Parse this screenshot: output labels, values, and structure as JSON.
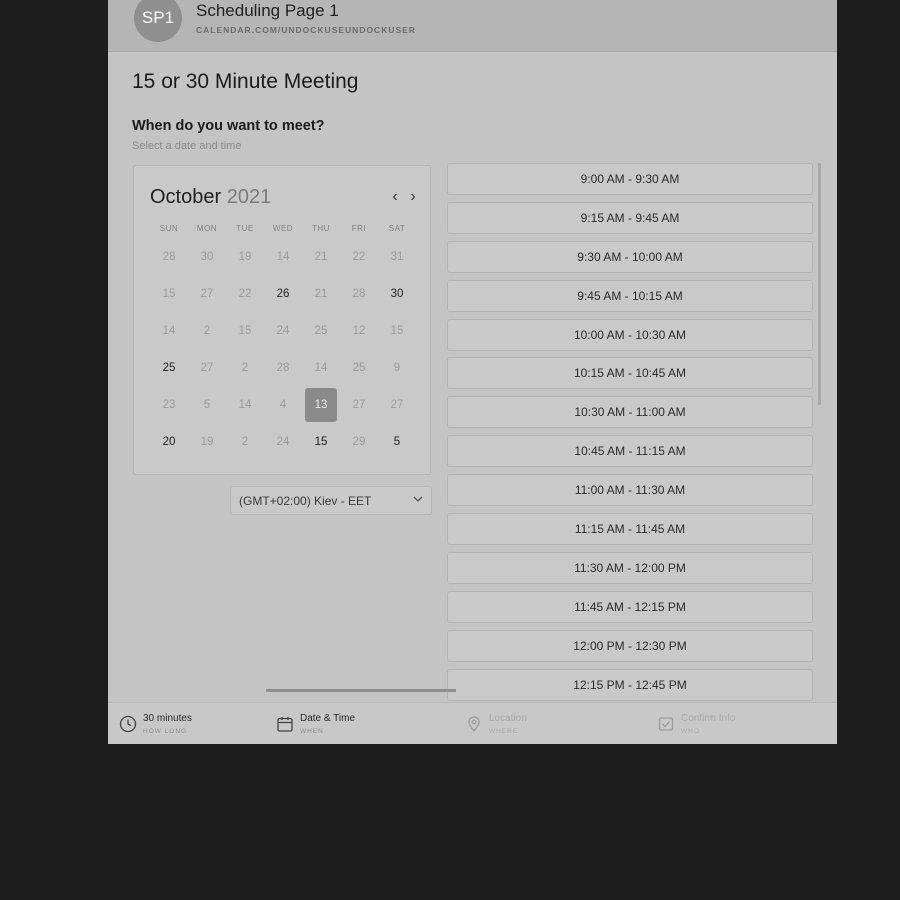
{
  "header": {
    "avatar_initials": "SP1",
    "page_name": "Scheduling Page 1",
    "page_url": "CALENDAR.COM/UNDOCKUSEUNDOCKUSER"
  },
  "meeting": {
    "title": "15 or 30 Minute Meeting",
    "question": "When do you want to meet?",
    "subtitle": "Select a date and time"
  },
  "calendar": {
    "month": "October",
    "year": "2021",
    "prev_icon": "chevron-left-icon",
    "next_icon": "chevron-right-icon",
    "weekdays": [
      "SUN",
      "MON",
      "TUE",
      "WED",
      "THU",
      "FRI",
      "SAT"
    ],
    "days": [
      "28",
      "30",
      "19",
      "14",
      "21",
      "22",
      "31",
      "15",
      "27",
      "22",
      "26",
      "21",
      "28",
      "30",
      "14",
      "2",
      "15",
      "24",
      "25",
      "12",
      "15",
      "25",
      "27",
      "2",
      "28",
      "14",
      "25",
      "9",
      "23",
      "5",
      "14",
      "4",
      "13",
      "27",
      "27",
      "20",
      "19",
      "2",
      "24",
      "15",
      "29",
      "5"
    ],
    "available": [
      10,
      13,
      21,
      35,
      39,
      41
    ],
    "selected": 32,
    "selected_day": "13"
  },
  "timezone": {
    "label": "(GMT+02:00) Kiev - EET",
    "icon": "chevron-down-icon"
  },
  "time_slots": [
    "9:00 AM - 9:30 AM",
    "9:15 AM - 9:45 AM",
    "9:30 AM - 10:00 AM",
    "9:45 AM - 10:15 AM",
    "10:00 AM - 10:30 AM",
    "10:15 AM - 10:45 AM",
    "10:30 AM - 11:00 AM",
    "10:45 AM - 11:15 AM",
    "11:00 AM - 11:30 AM",
    "11:15 AM - 11:45 AM",
    "11:30 AM - 12:00 PM",
    "11:45 AM - 12:15 PM",
    "12:00 PM - 12:30 PM",
    "12:15 PM - 12:45 PM"
  ],
  "steps": [
    {
      "label": "30 minutes",
      "sub": "HOW LONG",
      "icon": "clock-icon"
    },
    {
      "label": "Date & Time",
      "sub": "WHEN",
      "icon": "calendar-icon"
    },
    {
      "label": "Location",
      "sub": "WHERE",
      "icon": "location-pin-icon"
    },
    {
      "label": "Confirm Info",
      "sub": "WHO",
      "icon": "confirm-icon"
    }
  ]
}
